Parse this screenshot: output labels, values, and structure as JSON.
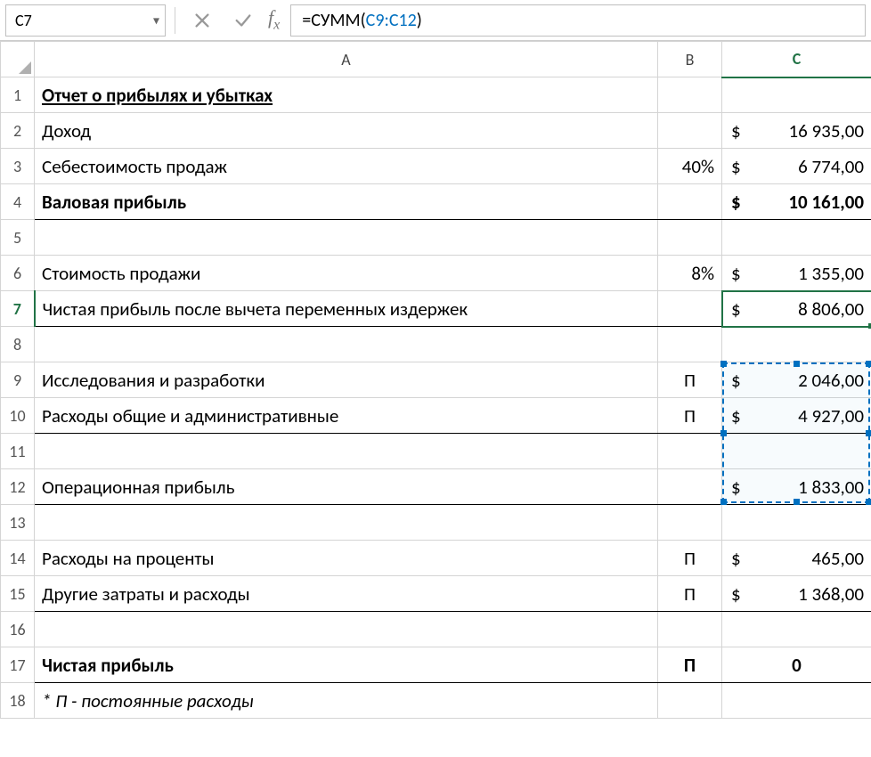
{
  "formula_bar": {
    "cell_ref": "C7",
    "formula_prefix": "=СУММ(",
    "formula_range": "C9:C12",
    "formula_suffix": ")"
  },
  "columns": {
    "a": "A",
    "b": "B",
    "c": "C"
  },
  "row_labels": [
    "1",
    "2",
    "3",
    "4",
    "5",
    "6",
    "7",
    "8",
    "9",
    "10",
    "11",
    "12",
    "13",
    "14",
    "15",
    "16",
    "17",
    "18"
  ],
  "cells": {
    "a1": "Отчет о прибылях и убытках",
    "a2": "Доход",
    "c2_val": "16 935,00",
    "a3": "Себестоимость продаж",
    "b3": "40%",
    "c3_val": "6 774,00",
    "a4": "Валовая прибыль",
    "c4_val": "10 161,00",
    "a6": "Стоимость продажи",
    "b6": "8%",
    "c6_val": "1 355,00",
    "a7": "Чистая прибыль после вычета переменных издержек",
    "c7_val": "8 806,00",
    "a9": "Исследования и разработки",
    "b9": "П",
    "c9_val": "2 046,00",
    "a10": "Расходы общие и административные",
    "b10": "П",
    "c10_val": "4 927,00",
    "a12": "Операционная прибыль",
    "c12_val": "1 833,00",
    "a14": "Расходы на проценты",
    "b14": "П",
    "c14_val": "465,00",
    "a15": "Другие затраты и расходы",
    "b15": "П",
    "c15_val": "1 368,00",
    "a17": "Чистая прибыль",
    "b17": "П",
    "c17": "0",
    "a18": "* П - постоянные расходы",
    "currency": "$"
  }
}
